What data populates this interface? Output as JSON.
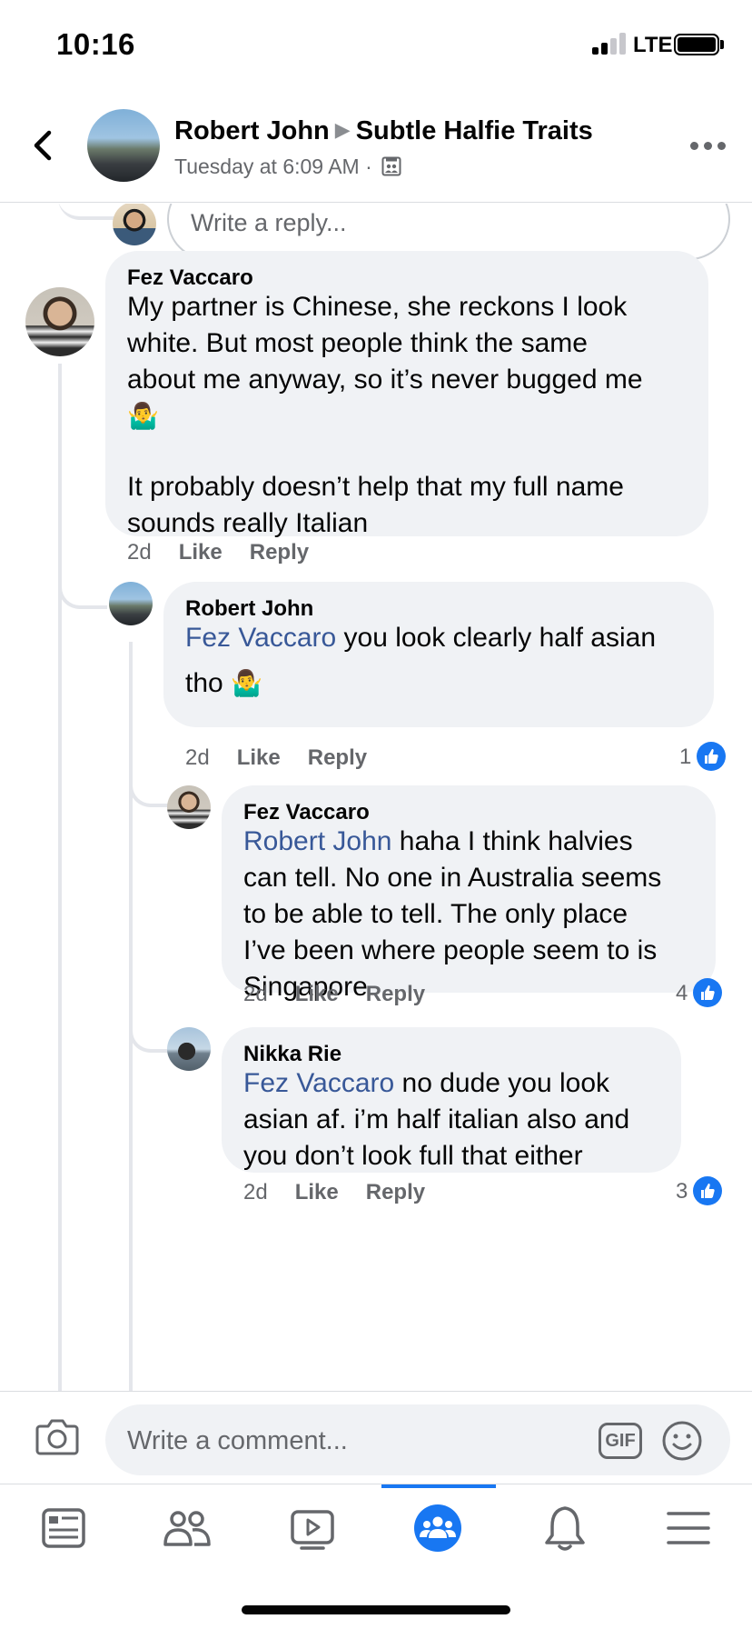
{
  "status_bar": {
    "time": "10:16",
    "network": "LTE"
  },
  "header": {
    "author": "Robert John",
    "group": "Subtle Halfie Traits",
    "timestamp": "Tuesday at 6:09 AM ·"
  },
  "reply_prompt": {
    "placeholder": "Write a reply..."
  },
  "comments": [
    {
      "author": "Fez Vaccaro",
      "text_lines": [
        "My partner is Chinese, she reckons I look",
        "white. But most people think the same",
        "about me anyway, so it’s never bugged me"
      ],
      "emoji": "🤷‍♂️",
      "text2_lines": [
        "It probably doesn’t help that my full name",
        "sounds really Italian"
      ],
      "time": "2d",
      "like": "Like",
      "reply": "Reply"
    },
    {
      "author": "Robert John",
      "mention": "Fez Vaccaro",
      "text": " you look clearly half asian",
      "text_line2": "tho",
      "emoji": "🤷‍♂️",
      "time": "2d",
      "like": "Like",
      "reply": "Reply",
      "reactions": "1"
    },
    {
      "author": "Fez Vaccaro",
      "mention": "Robert John",
      "text_line1": " haha I think halvies",
      "text_lines": [
        "can tell. No one in Australia seems",
        "to be able to tell. The only place",
        "I’ve been where people seem to is",
        "Singapore"
      ],
      "time": "2d",
      "like": "Like",
      "reply": "Reply",
      "reactions": "4"
    },
    {
      "author": "Nikka Rie",
      "mention": "Fez Vaccaro",
      "text_line1": " no dude you look",
      "text_lines": [
        "asian af. i’m half italian also and",
        "you don’t look full that either"
      ],
      "time": "2d",
      "like": "Like",
      "reply": "Reply",
      "reactions": "3"
    }
  ],
  "composer": {
    "placeholder": "Write a comment...",
    "gif_label": "GIF"
  },
  "tabs": [
    "news-feed",
    "friends",
    "watch",
    "groups",
    "notifications",
    "menu"
  ],
  "colors": {
    "accent": "#1877f2",
    "mention": "#385898",
    "bubble": "#f0f2f5",
    "secondary_text": "#65676b"
  }
}
